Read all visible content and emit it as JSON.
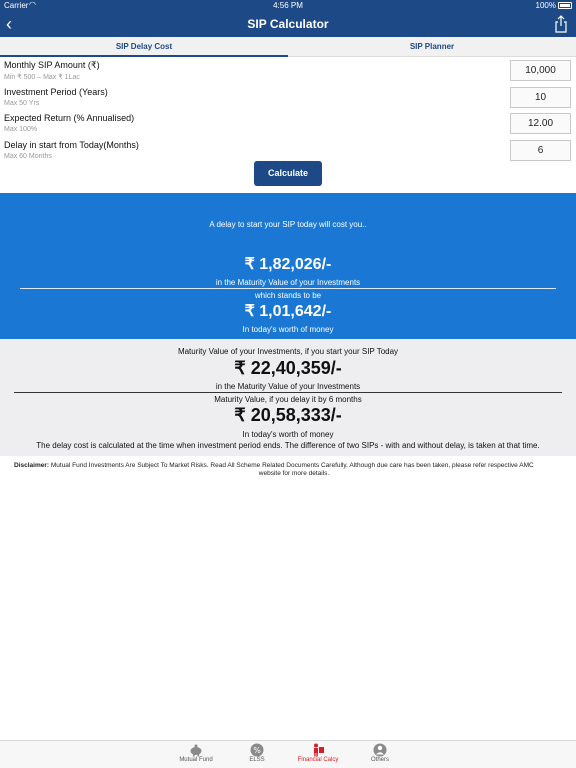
{
  "status": {
    "carrier": "Carrier",
    "time": "4:56 PM",
    "battery": "100%"
  },
  "nav": {
    "title": "SIP Calculator"
  },
  "tabs": [
    {
      "label": "SIP Delay Cost",
      "active": true
    },
    {
      "label": "SIP Planner",
      "active": false
    }
  ],
  "fields": [
    {
      "label": "Monthly SIP Amount (₹)",
      "hint": "Min ₹ 500 – Max ₹ 1Lac",
      "value": "10,000"
    },
    {
      "label": "Investment Period (Years)",
      "hint": "Max 50 Yrs",
      "value": "10"
    },
    {
      "label": "Expected Return (% Annualised)",
      "hint": "Max 100%",
      "value": "12.00"
    },
    {
      "label": "Delay in start from Today(Months)",
      "hint": "Max 60 Months",
      "value": "6"
    }
  ],
  "calculate_label": "Calculate",
  "result_blue": {
    "intro": "A delay to start your SIP today will cost you..",
    "amount1": "₹ 1,82,026/-",
    "sub1": "in the Maturity Value of your Investments",
    "stands": "which stands to be",
    "amount2": "₹ 1,01,642/-",
    "sub2": "In today's worth of money"
  },
  "result_gray": {
    "t1": "Maturity Value of your Investments, if you start your SIP Today",
    "amount3": "₹ 22,40,359/-",
    "t2": "in the Maturity Value of your Investments",
    "t3": "Maturity Value, if you delay it by 6 months",
    "amount4": "₹ 20,58,333/-",
    "t4": "In today's worth of money",
    "t5": "The delay cost is calculated at the time when investment period ends. The difference of two SIPs - with and without delay, is taken at that time."
  },
  "disclaimer": {
    "label": "Disclaimer:",
    "text1": "Mutual Fund Investments Are Subject To Market Risks. Read All Scheme Related Documents Carefully. Although due care has been taken, please refer respective AMC",
    "text2": "website for more details."
  },
  "tabbar": [
    {
      "label": "Mutual Fund",
      "icon": "piggy-bank-icon",
      "active": false
    },
    {
      "label": "ELSS",
      "icon": "percent-icon",
      "active": false
    },
    {
      "label": "Financial Calcy",
      "icon": "calculator-person-icon",
      "active": true
    },
    {
      "label": "Others",
      "icon": "person-icon",
      "active": false
    }
  ],
  "colors": {
    "primary": "#1d4a86",
    "result_blue": "#1a78d4",
    "active_tab": "#d4202c"
  }
}
